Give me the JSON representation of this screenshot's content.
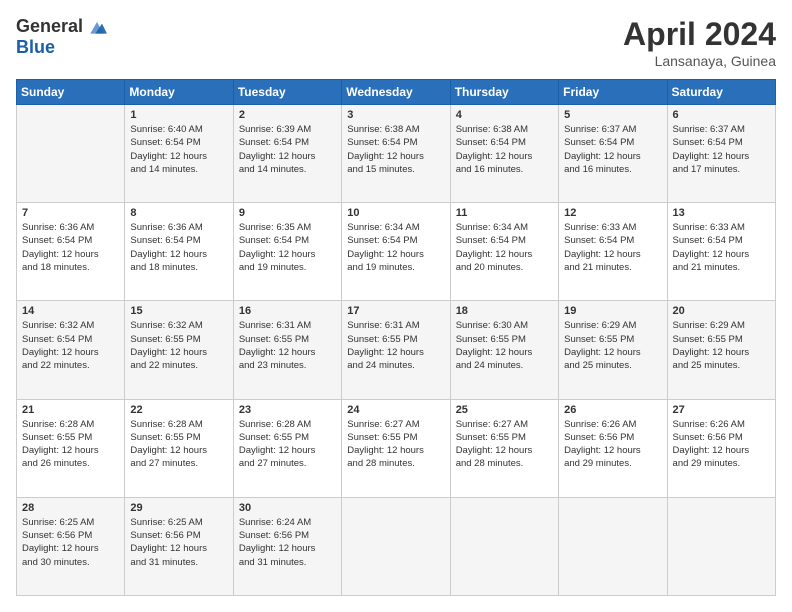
{
  "logo": {
    "general": "General",
    "blue": "Blue"
  },
  "header": {
    "month": "April 2024",
    "location": "Lansanaya, Guinea"
  },
  "weekdays": [
    "Sunday",
    "Monday",
    "Tuesday",
    "Wednesday",
    "Thursday",
    "Friday",
    "Saturday"
  ],
  "weeks": [
    [
      {
        "day": "",
        "info": ""
      },
      {
        "day": "1",
        "info": "Sunrise: 6:40 AM\nSunset: 6:54 PM\nDaylight: 12 hours\nand 14 minutes."
      },
      {
        "day": "2",
        "info": "Sunrise: 6:39 AM\nSunset: 6:54 PM\nDaylight: 12 hours\nand 14 minutes."
      },
      {
        "day": "3",
        "info": "Sunrise: 6:38 AM\nSunset: 6:54 PM\nDaylight: 12 hours\nand 15 minutes."
      },
      {
        "day": "4",
        "info": "Sunrise: 6:38 AM\nSunset: 6:54 PM\nDaylight: 12 hours\nand 16 minutes."
      },
      {
        "day": "5",
        "info": "Sunrise: 6:37 AM\nSunset: 6:54 PM\nDaylight: 12 hours\nand 16 minutes."
      },
      {
        "day": "6",
        "info": "Sunrise: 6:37 AM\nSunset: 6:54 PM\nDaylight: 12 hours\nand 17 minutes."
      }
    ],
    [
      {
        "day": "7",
        "info": "Sunrise: 6:36 AM\nSunset: 6:54 PM\nDaylight: 12 hours\nand 18 minutes."
      },
      {
        "day": "8",
        "info": "Sunrise: 6:36 AM\nSunset: 6:54 PM\nDaylight: 12 hours\nand 18 minutes."
      },
      {
        "day": "9",
        "info": "Sunrise: 6:35 AM\nSunset: 6:54 PM\nDaylight: 12 hours\nand 19 minutes."
      },
      {
        "day": "10",
        "info": "Sunrise: 6:34 AM\nSunset: 6:54 PM\nDaylight: 12 hours\nand 19 minutes."
      },
      {
        "day": "11",
        "info": "Sunrise: 6:34 AM\nSunset: 6:54 PM\nDaylight: 12 hours\nand 20 minutes."
      },
      {
        "day": "12",
        "info": "Sunrise: 6:33 AM\nSunset: 6:54 PM\nDaylight: 12 hours\nand 21 minutes."
      },
      {
        "day": "13",
        "info": "Sunrise: 6:33 AM\nSunset: 6:54 PM\nDaylight: 12 hours\nand 21 minutes."
      }
    ],
    [
      {
        "day": "14",
        "info": "Sunrise: 6:32 AM\nSunset: 6:54 PM\nDaylight: 12 hours\nand 22 minutes."
      },
      {
        "day": "15",
        "info": "Sunrise: 6:32 AM\nSunset: 6:55 PM\nDaylight: 12 hours\nand 22 minutes."
      },
      {
        "day": "16",
        "info": "Sunrise: 6:31 AM\nSunset: 6:55 PM\nDaylight: 12 hours\nand 23 minutes."
      },
      {
        "day": "17",
        "info": "Sunrise: 6:31 AM\nSunset: 6:55 PM\nDaylight: 12 hours\nand 24 minutes."
      },
      {
        "day": "18",
        "info": "Sunrise: 6:30 AM\nSunset: 6:55 PM\nDaylight: 12 hours\nand 24 minutes."
      },
      {
        "day": "19",
        "info": "Sunrise: 6:29 AM\nSunset: 6:55 PM\nDaylight: 12 hours\nand 25 minutes."
      },
      {
        "day": "20",
        "info": "Sunrise: 6:29 AM\nSunset: 6:55 PM\nDaylight: 12 hours\nand 25 minutes."
      }
    ],
    [
      {
        "day": "21",
        "info": "Sunrise: 6:28 AM\nSunset: 6:55 PM\nDaylight: 12 hours\nand 26 minutes."
      },
      {
        "day": "22",
        "info": "Sunrise: 6:28 AM\nSunset: 6:55 PM\nDaylight: 12 hours\nand 27 minutes."
      },
      {
        "day": "23",
        "info": "Sunrise: 6:28 AM\nSunset: 6:55 PM\nDaylight: 12 hours\nand 27 minutes."
      },
      {
        "day": "24",
        "info": "Sunrise: 6:27 AM\nSunset: 6:55 PM\nDaylight: 12 hours\nand 28 minutes."
      },
      {
        "day": "25",
        "info": "Sunrise: 6:27 AM\nSunset: 6:55 PM\nDaylight: 12 hours\nand 28 minutes."
      },
      {
        "day": "26",
        "info": "Sunrise: 6:26 AM\nSunset: 6:56 PM\nDaylight: 12 hours\nand 29 minutes."
      },
      {
        "day": "27",
        "info": "Sunrise: 6:26 AM\nSunset: 6:56 PM\nDaylight: 12 hours\nand 29 minutes."
      }
    ],
    [
      {
        "day": "28",
        "info": "Sunrise: 6:25 AM\nSunset: 6:56 PM\nDaylight: 12 hours\nand 30 minutes."
      },
      {
        "day": "29",
        "info": "Sunrise: 6:25 AM\nSunset: 6:56 PM\nDaylight: 12 hours\nand 31 minutes."
      },
      {
        "day": "30",
        "info": "Sunrise: 6:24 AM\nSunset: 6:56 PM\nDaylight: 12 hours\nand 31 minutes."
      },
      {
        "day": "",
        "info": ""
      },
      {
        "day": "",
        "info": ""
      },
      {
        "day": "",
        "info": ""
      },
      {
        "day": "",
        "info": ""
      }
    ]
  ]
}
